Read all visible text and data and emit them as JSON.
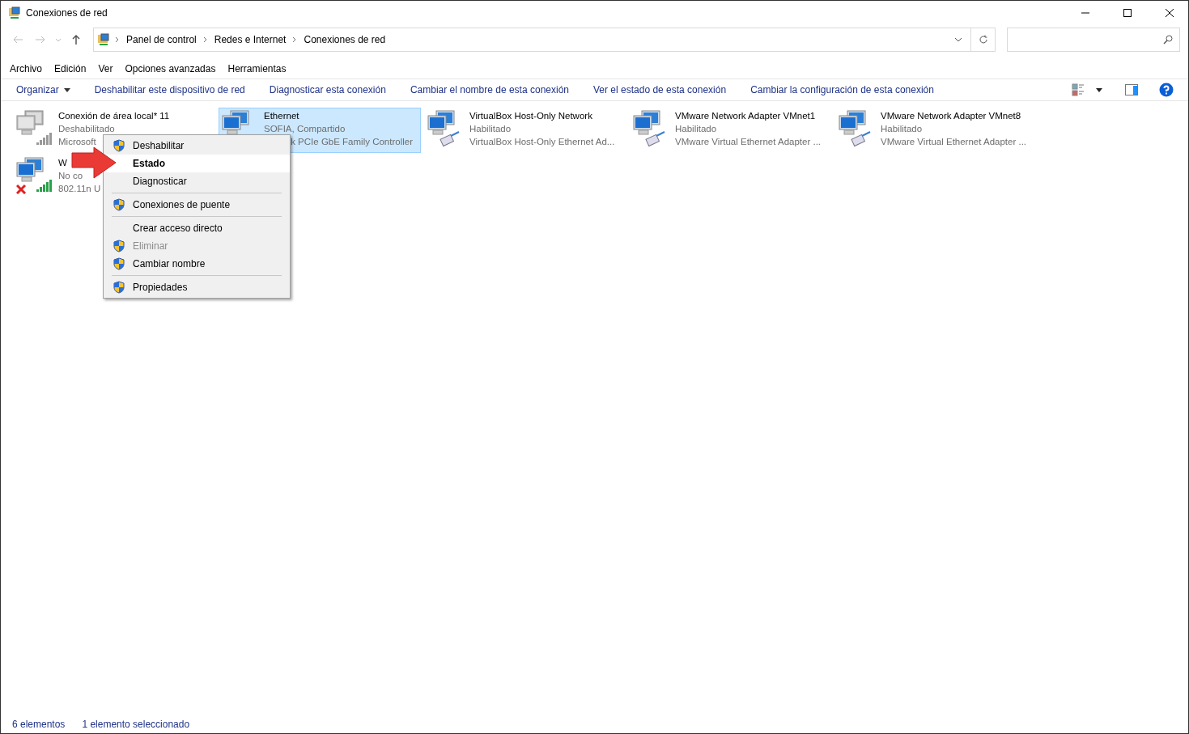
{
  "window": {
    "title": "Conexiones de red"
  },
  "address": {
    "crumbs": [
      "Panel de control",
      "Redes e Internet",
      "Conexiones de red"
    ]
  },
  "menu_bar": [
    "Archivo",
    "Edición",
    "Ver",
    "Opciones avanzadas",
    "Herramientas"
  ],
  "command_bar": [
    {
      "label": "Organizar",
      "dropdown": true
    },
    {
      "label": "Deshabilitar este dispositivo de red",
      "dropdown": false
    },
    {
      "label": "Diagnosticar esta conexión",
      "dropdown": false
    },
    {
      "label": "Cambiar el nombre de esta conexión",
      "dropdown": false
    },
    {
      "label": "Ver el estado de esta conexión",
      "dropdown": false
    },
    {
      "label": "Cambiar la configuración de esta conexión",
      "dropdown": false
    }
  ],
  "connections": [
    {
      "kind": "disabled",
      "name": "Conexión de área local* 11",
      "status": "Deshabilitado",
      "device": "Microsoft",
      "selected": false,
      "device_cut_left": false
    },
    {
      "kind": "ethernet",
      "name": "Ethernet",
      "status": "SOFIA, Compartido",
      "device": "k PCIe GbE Family Controller",
      "selected": true,
      "device_cut_left": true
    },
    {
      "kind": "virtual",
      "name": "VirtualBox Host-Only Network",
      "status": "Habilitado",
      "device": "VirtualBox Host-Only Ethernet Ad...",
      "selected": false,
      "device_cut_left": false
    },
    {
      "kind": "virtual",
      "name": "VMware Network Adapter VMnet1",
      "status": "Habilitado",
      "device": "VMware Virtual Ethernet Adapter ...",
      "selected": false,
      "device_cut_left": false
    },
    {
      "kind": "virtual",
      "name": "VMware Network Adapter VMnet8",
      "status": "Habilitado",
      "device": "VMware Virtual Ethernet Adapter ...",
      "selected": false,
      "device_cut_left": false
    },
    {
      "kind": "wifi",
      "name": "W",
      "status": "No co",
      "device": "802.11n U",
      "selected": false,
      "device_cut_left": false
    }
  ],
  "context_menu": [
    {
      "kind": "item",
      "label": "Deshabilitar",
      "shield": true,
      "bold": false,
      "disabled": false,
      "selected": false
    },
    {
      "kind": "item",
      "label": "Estado",
      "shield": false,
      "bold": true,
      "disabled": false,
      "selected": true
    },
    {
      "kind": "item",
      "label": "Diagnosticar",
      "shield": false,
      "bold": false,
      "disabled": false,
      "selected": false
    },
    {
      "kind": "separator"
    },
    {
      "kind": "item",
      "label": "Conexiones de puente",
      "shield": true,
      "bold": false,
      "disabled": false,
      "selected": false
    },
    {
      "kind": "separator"
    },
    {
      "kind": "item",
      "label": "Crear acceso directo",
      "shield": false,
      "bold": false,
      "disabled": false,
      "selected": false
    },
    {
      "kind": "item",
      "label": "Eliminar",
      "shield": true,
      "bold": false,
      "disabled": true,
      "selected": false
    },
    {
      "kind": "item",
      "label": "Cambiar nombre",
      "shield": true,
      "bold": false,
      "disabled": false,
      "selected": false
    },
    {
      "kind": "separator"
    },
    {
      "kind": "item",
      "label": "Propiedades",
      "shield": true,
      "bold": false,
      "disabled": false,
      "selected": false
    }
  ],
  "status_bar": [
    "6 elementos",
    "1 elemento seleccionado"
  ]
}
